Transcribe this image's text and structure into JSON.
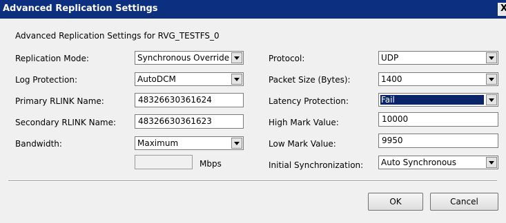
{
  "window": {
    "title": "Advanced Replication Settings",
    "close_label": "X"
  },
  "subtitle": "Advanced Replication Settings for RVG_TESTFS_0",
  "left": {
    "replication_mode": {
      "label": "Replication Mode:",
      "value": "Synchronous Override"
    },
    "log_protection": {
      "label": "Log Protection:",
      "value": "AutoDCM"
    },
    "primary_rlink": {
      "label": "Primary RLINK Name:",
      "value": "48326630361624"
    },
    "secondary_rlink": {
      "label": "Secondary RLINK Name:",
      "value": "48326630361623"
    },
    "bandwidth": {
      "label": "Bandwidth:",
      "value": "Maximum"
    },
    "bandwidth_rate": {
      "value": "",
      "unit": "Mbps"
    }
  },
  "right": {
    "protocol": {
      "label": "Protocol:",
      "value": "UDP"
    },
    "packet_size": {
      "label": "Packet Size (Bytes):",
      "value": "1400"
    },
    "latency_protection": {
      "label": "Latency Protection:",
      "value": "Fail"
    },
    "high_mark": {
      "label": "High Mark Value:",
      "value": "10000"
    },
    "low_mark": {
      "label": "Low Mark Value:",
      "value": "9950"
    },
    "initial_sync": {
      "label": "Initial Synchronization:",
      "value": "Auto Synchronous"
    }
  },
  "buttons": {
    "ok": "OK",
    "cancel": "Cancel"
  },
  "colors": {
    "titlebar": "#0c2f7f",
    "selection": "#0a246a",
    "background": "#f0f0f0"
  }
}
